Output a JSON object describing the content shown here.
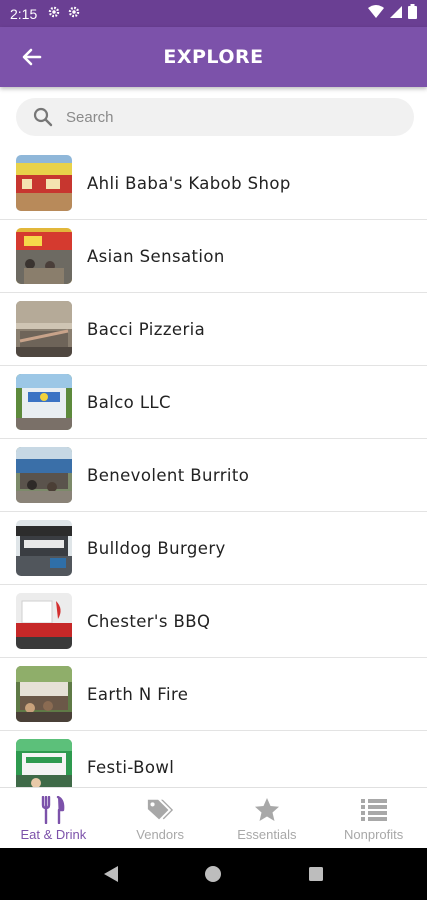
{
  "status_bar": {
    "time": "2:15"
  },
  "header": {
    "title": "EXPLORE"
  },
  "search": {
    "placeholder": "Search"
  },
  "vendors": [
    {
      "name": "Ahli Baba's Kabob Shop"
    },
    {
      "name": "Asian Sensation"
    },
    {
      "name": "Bacci Pizzeria"
    },
    {
      "name": "Balco LLC"
    },
    {
      "name": "Benevolent Burrito"
    },
    {
      "name": "Bulldog Burgery"
    },
    {
      "name": "Chester's BBQ"
    },
    {
      "name": "Earth N Fire"
    },
    {
      "name": "Festi-Bowl"
    }
  ],
  "bottom_nav": {
    "tabs": [
      {
        "label": "Eat & Drink",
        "icon": "fork-knife-icon",
        "active": true
      },
      {
        "label": "Vendors",
        "icon": "tags-icon",
        "active": false
      },
      {
        "label": "Essentials",
        "icon": "star-icon",
        "active": false
      },
      {
        "label": "Nonprofits",
        "icon": "list-icon",
        "active": false
      }
    ]
  },
  "colors": {
    "primary": "#7c52aa",
    "status_bar": "#6a3f93",
    "inactive": "#a8a8a8"
  }
}
